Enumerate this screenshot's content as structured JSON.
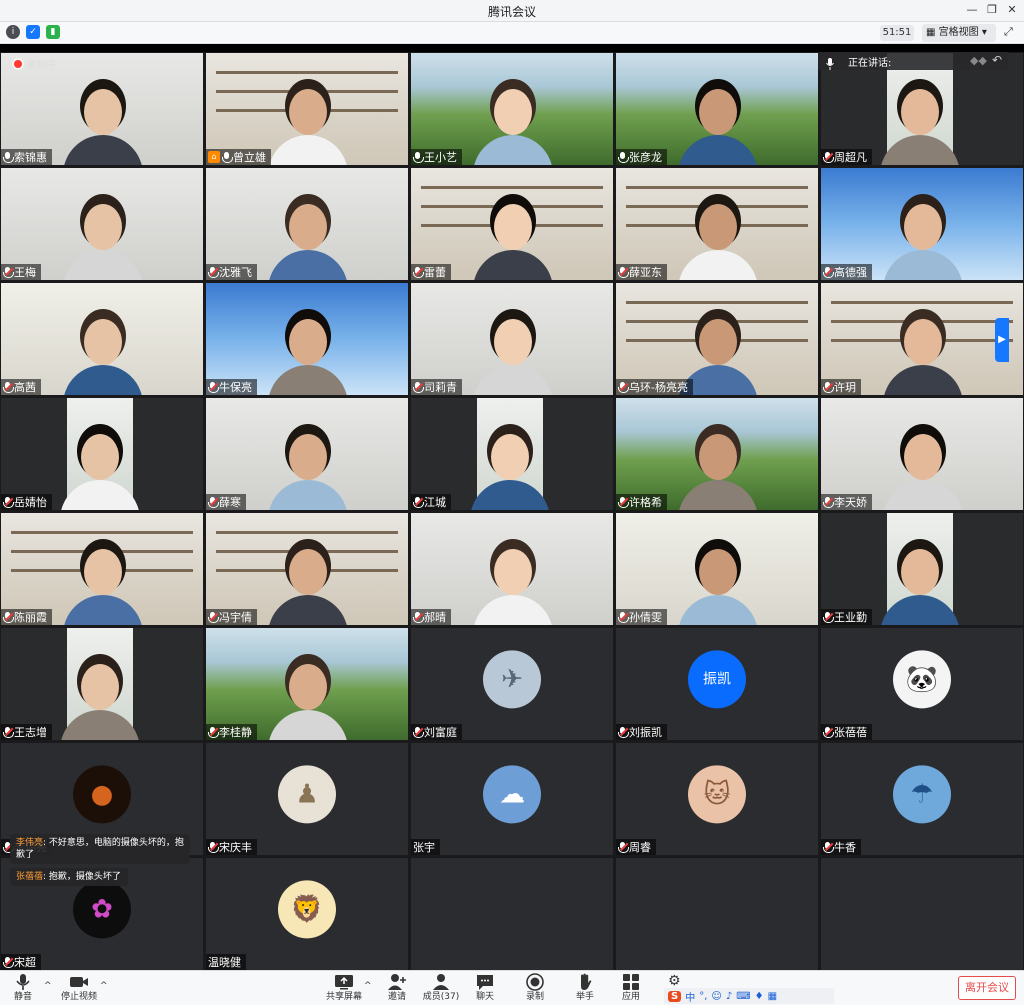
{
  "window": {
    "title": "腾讯会议",
    "controls": [
      "—",
      "❐",
      "✕"
    ]
  },
  "top_toolbar": {
    "timer": "51:51",
    "view_mode": "宫格视图",
    "icons": [
      "info-icon",
      "shield-icon",
      "signal-icon",
      "fullscreen-icon"
    ]
  },
  "recording": {
    "label": "录制中"
  },
  "speaking": {
    "label": "正在讲话:"
  },
  "participants": [
    {
      "name": "索锦惠",
      "muted": false,
      "kind": "video",
      "bg": "room"
    },
    {
      "name": "曾立雄",
      "muted": false,
      "kind": "video",
      "bg": "shelf",
      "host": true
    },
    {
      "name": "王小艺",
      "muted": false,
      "kind": "video",
      "bg": "land"
    },
    {
      "name": "张彦龙",
      "muted": false,
      "kind": "video",
      "bg": "land"
    },
    {
      "name": "周超凡",
      "muted": true,
      "kind": "video",
      "bg": "dark-inset"
    },
    {
      "name": "王梅",
      "muted": true,
      "kind": "video",
      "bg": "room"
    },
    {
      "name": "沈雅飞",
      "muted": true,
      "kind": "video",
      "bg": "room"
    },
    {
      "name": "雷蕾",
      "muted": true,
      "kind": "video",
      "bg": "shelf"
    },
    {
      "name": "薛亚东",
      "muted": true,
      "kind": "video",
      "bg": "shelf"
    },
    {
      "name": "高德强",
      "muted": true,
      "kind": "video",
      "bg": "sky"
    },
    {
      "name": "高茜",
      "muted": true,
      "kind": "video",
      "bg": "office"
    },
    {
      "name": "牛保亮",
      "muted": true,
      "kind": "video",
      "bg": "sky"
    },
    {
      "name": "司莉青",
      "muted": true,
      "kind": "video",
      "bg": "room"
    },
    {
      "name": "乌环-杨亮亮",
      "muted": true,
      "kind": "video",
      "bg": "shelf"
    },
    {
      "name": "许玥",
      "muted": true,
      "kind": "video",
      "bg": "shelf"
    },
    {
      "name": "岳婧怡",
      "muted": true,
      "kind": "video",
      "bg": "dark-inset"
    },
    {
      "name": "薛寒",
      "muted": true,
      "kind": "video",
      "bg": "room"
    },
    {
      "name": "江城",
      "muted": true,
      "kind": "video",
      "bg": "dark-inset"
    },
    {
      "name": "许格希",
      "muted": true,
      "kind": "video",
      "bg": "land"
    },
    {
      "name": "李天娇",
      "muted": true,
      "kind": "video",
      "bg": "room"
    },
    {
      "name": "陈丽霞",
      "muted": true,
      "kind": "video",
      "bg": "shelf"
    },
    {
      "name": "冯宇倩",
      "muted": true,
      "kind": "video",
      "bg": "shelf"
    },
    {
      "name": "郝晴",
      "muted": true,
      "kind": "video",
      "bg": "room"
    },
    {
      "name": "孙倩雯",
      "muted": true,
      "kind": "video",
      "bg": "office"
    },
    {
      "name": "王业勤",
      "muted": true,
      "kind": "video",
      "bg": "dark-inset"
    },
    {
      "name": "王志增",
      "muted": true,
      "kind": "video",
      "bg": "dark-inset"
    },
    {
      "name": "李桂静",
      "muted": true,
      "kind": "video",
      "bg": "land"
    },
    {
      "name": "刘富庭",
      "muted": true,
      "kind": "avatar",
      "avatar_icon": "jet-icon"
    },
    {
      "name": "刘振凯",
      "muted": true,
      "kind": "avatar-text",
      "avatar_text": "振凯"
    },
    {
      "name": "张蓓蓓",
      "muted": true,
      "kind": "avatar",
      "avatar_icon": "panda-icon"
    },
    {
      "name": "李伟亮",
      "muted": true,
      "kind": "avatar",
      "avatar_icon": "moon-icon"
    },
    {
      "name": "宋庆丰",
      "muted": true,
      "kind": "avatar",
      "avatar_icon": "portrait-icon"
    },
    {
      "name": "张宇",
      "muted": false,
      "kind": "avatar",
      "avatar_icon": "clouds-icon",
      "no_icon": true
    },
    {
      "name": "周睿",
      "muted": true,
      "kind": "avatar",
      "avatar_icon": "cat-icon"
    },
    {
      "name": "牛香",
      "muted": true,
      "kind": "avatar",
      "avatar_icon": "blue-scene-icon"
    },
    {
      "name": "宋超",
      "muted": true,
      "kind": "avatar",
      "avatar_icon": "flower-icon"
    },
    {
      "name": "温晓健",
      "muted": false,
      "kind": "avatar",
      "avatar_icon": "lion-icon",
      "no_icon": true
    },
    {
      "name": "",
      "kind": "empty"
    },
    {
      "name": "",
      "kind": "empty"
    },
    {
      "name": "",
      "kind": "empty"
    }
  ],
  "chat_messages": [
    {
      "sender": "李伟亮",
      "text": "不好意思，电脑的摄像头坏的，抱歉了"
    },
    {
      "sender": "张蓓蓓",
      "text": "抱歉，摄像头坏了"
    }
  ],
  "bottom_toolbar": {
    "buttons": [
      {
        "label": "静音",
        "icon": "mic-icon"
      },
      {
        "label": "停止视频",
        "icon": "camera-icon"
      },
      {
        "label": "共享屏幕",
        "icon": "share-screen-icon"
      },
      {
        "label": "邀请",
        "icon": "invite-icon"
      },
      {
        "label": "成员(37)",
        "icon": "members-icon"
      },
      {
        "label": "聊天",
        "icon": "chat-icon"
      },
      {
        "label": "录制",
        "icon": "record-icon"
      },
      {
        "label": "举手",
        "icon": "hand-icon"
      },
      {
        "label": "应用",
        "icon": "apps-icon"
      }
    ],
    "leave": "离开会议"
  },
  "ime": {
    "label": "中"
  },
  "colors": {
    "accent": "#1677ff",
    "leave": "#e34c4c",
    "grid_bg": "#2b2c2f",
    "sender_name": "#ff9d3a"
  }
}
